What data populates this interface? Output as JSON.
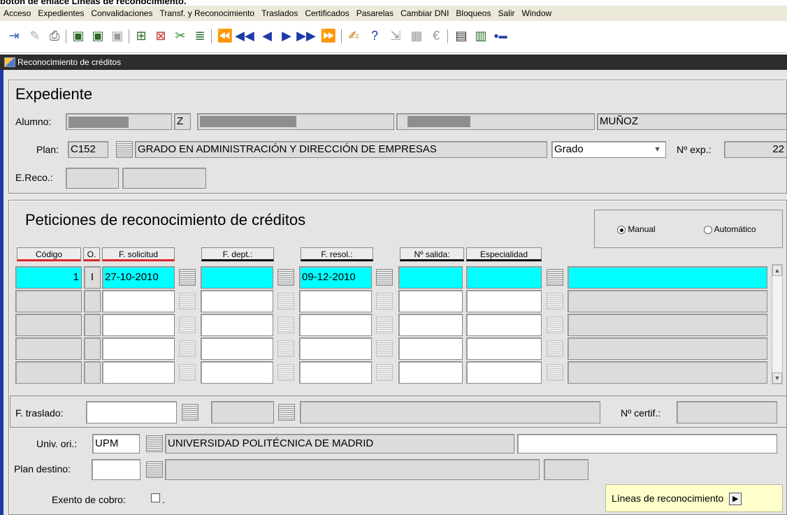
{
  "caption": "botón de enlace Líneas de reconocimiento.",
  "menu": [
    "Acceso",
    "Expedientes",
    "Convalidaciones",
    "Transf. y Reconocimiento",
    "Traslados",
    "Certificados",
    "Pasarelas",
    "Cambiar DNI",
    "Bloqueos",
    "Salir",
    "Window"
  ],
  "window_title": "Reconocimiento de créditos",
  "expediente": {
    "title": "Expediente",
    "alumno_label": "Alumno:",
    "alumno_initial": "Z",
    "alumno_apellido2": "MUÑOZ",
    "plan_label": "Plan:",
    "plan_code": "C152",
    "plan_name": "GRADO EN ADMINISTRACIÓN Y DIRECCIÓN DE EMPRESAS",
    "plan_type": "Grado",
    "nexp_label": "Nº exp.:",
    "nexp_value": "22",
    "ereco_label": "E.Reco.:"
  },
  "peticiones": {
    "title": "Peticiones de reconocimiento de créditos",
    "mode_manual": "Manual",
    "mode_auto": "Automático",
    "mode_selected": "Manual",
    "headers": {
      "codigo": "Código",
      "orden": "O.",
      "f_solicitud": "F. solicitud",
      "f_dept": "F. dept.:",
      "f_resol": "F. resol.:",
      "n_salida": "Nº salida:",
      "especialidad": "Especialidad"
    },
    "row1": {
      "codigo": "1",
      "orden": "I",
      "f_solicitud": "27-10-2010",
      "f_resol": "09-12-2010"
    }
  },
  "detail": {
    "f_traslado_label": "F. traslado:",
    "n_certif_label": "Nº certif.:",
    "univ_ori_label": "Univ. ori.:",
    "univ_ori_code": "UPM",
    "univ_ori_name": "UNIVERSIDAD POLITÉCNICA DE MADRID",
    "plan_destino_label": "Plan destino:",
    "exento_label": "Exento de cobro:",
    "exento_dot": ".",
    "lineas_button": "Líneas de reconocimiento"
  }
}
